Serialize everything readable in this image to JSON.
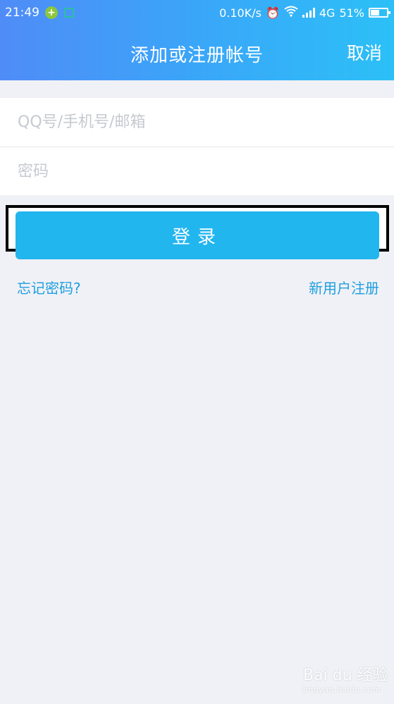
{
  "status_bar": {
    "time": "21:49",
    "network_speed": "0.10K/s",
    "network_type": "4G",
    "battery": "51%",
    "battery_level": 0.51,
    "icons": [
      "app-badge-icon",
      "scan-icon",
      "alarm-icon",
      "wifi-icon",
      "signal-icon",
      "battery-icon"
    ]
  },
  "header": {
    "title": "添加或注册帐号",
    "cancel_label": "取消"
  },
  "form": {
    "account_placeholder": "QQ号/手机号/邮箱",
    "password_placeholder": "密码"
  },
  "login_button": {
    "label": "登录"
  },
  "links": {
    "forgot_password": "忘记密码?",
    "register": "新用户注册"
  },
  "watermark": {
    "text": "Bai du 经验",
    "url": "jingyan.baidu.com"
  },
  "colors": {
    "header_gradient_start": "#4f8cf7",
    "header_gradient_end": "#2cc0f7",
    "button": "#22b6ef",
    "link": "#1e9fe0",
    "background": "#f0f1f6"
  }
}
